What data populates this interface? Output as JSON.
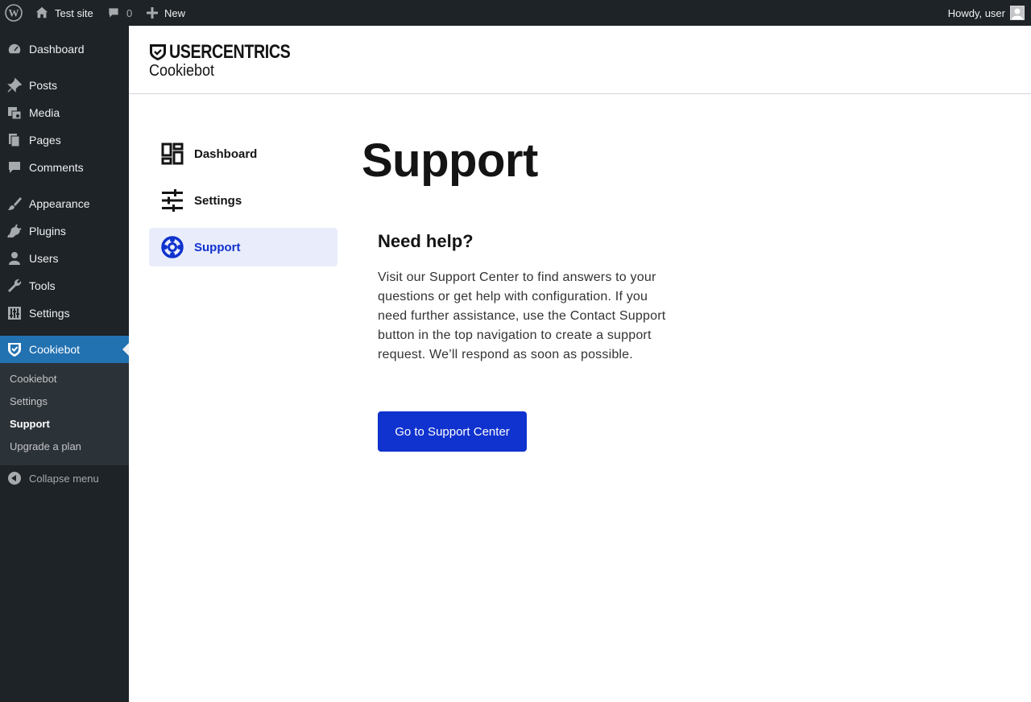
{
  "adminbar": {
    "site_name": "Test site",
    "comments_count": "0",
    "new_label": "New",
    "howdy": "Howdy, user"
  },
  "sidebar": {
    "items": [
      {
        "label": "Dashboard",
        "icon": "dashboard-icon"
      },
      {
        "label": "Posts",
        "icon": "pin-icon"
      },
      {
        "label": "Media",
        "icon": "media-icon"
      },
      {
        "label": "Pages",
        "icon": "pages-icon"
      },
      {
        "label": "Comments",
        "icon": "comment-icon"
      },
      {
        "label": "Appearance",
        "icon": "brush-icon"
      },
      {
        "label": "Plugins",
        "icon": "plug-icon"
      },
      {
        "label": "Users",
        "icon": "user-icon"
      },
      {
        "label": "Tools",
        "icon": "wrench-icon"
      },
      {
        "label": "Settings",
        "icon": "sliders-icon"
      },
      {
        "label": "Cookiebot",
        "icon": "shield-check-icon"
      }
    ],
    "submenu": [
      "Cookiebot",
      "Settings",
      "Support",
      "Upgrade a plan"
    ],
    "collapse_label": "Collapse menu"
  },
  "header": {
    "brand": "USERCENTRICS",
    "product": "Cookiebot"
  },
  "plugin_nav": [
    {
      "label": "Dashboard",
      "icon": "grid-dashboard-icon"
    },
    {
      "label": "Settings",
      "icon": "tune-icon"
    },
    {
      "label": "Support",
      "icon": "lifebuoy-icon"
    }
  ],
  "main": {
    "title": "Support",
    "help_title": "Need help?",
    "help_body": "Visit our Support Center to find answers to your questions or get help with configuration. If you need further assistance, use the Contact Support button in the top navigation to create a support request. We’ll respond as soon as possible.",
    "button_label": "Go to Support Center"
  },
  "colors": {
    "admin_dark": "#1d2327",
    "admin_accent": "#2271b1",
    "brand_blue": "#1032cf",
    "active_nav_bg": "#e9edfb"
  }
}
